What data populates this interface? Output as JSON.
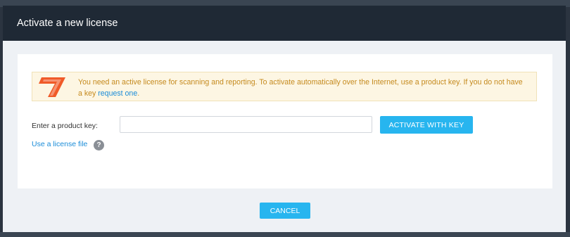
{
  "dialog": {
    "title": "Activate a new license"
  },
  "alert": {
    "logo_icon": "acunetix-logo-icon",
    "text": "You need an active license for scanning and reporting. To activate automatically over the Internet, use a product key. If you do not have a key ",
    "link_text": "request one",
    "link_suffix": "."
  },
  "form": {
    "key_label": "Enter a product key:",
    "key_value": "",
    "activate_label": "ACTIVATE WITH KEY",
    "license_file_label": "Use a license file",
    "help_icon": "?"
  },
  "footer": {
    "cancel_label": "CANCEL"
  },
  "colors": {
    "accent": "#27b5ef",
    "header_bg": "#1f2935",
    "alert_bg": "#fdf6e3",
    "alert_text": "#c58a1e",
    "link": "#1a8cd8"
  }
}
